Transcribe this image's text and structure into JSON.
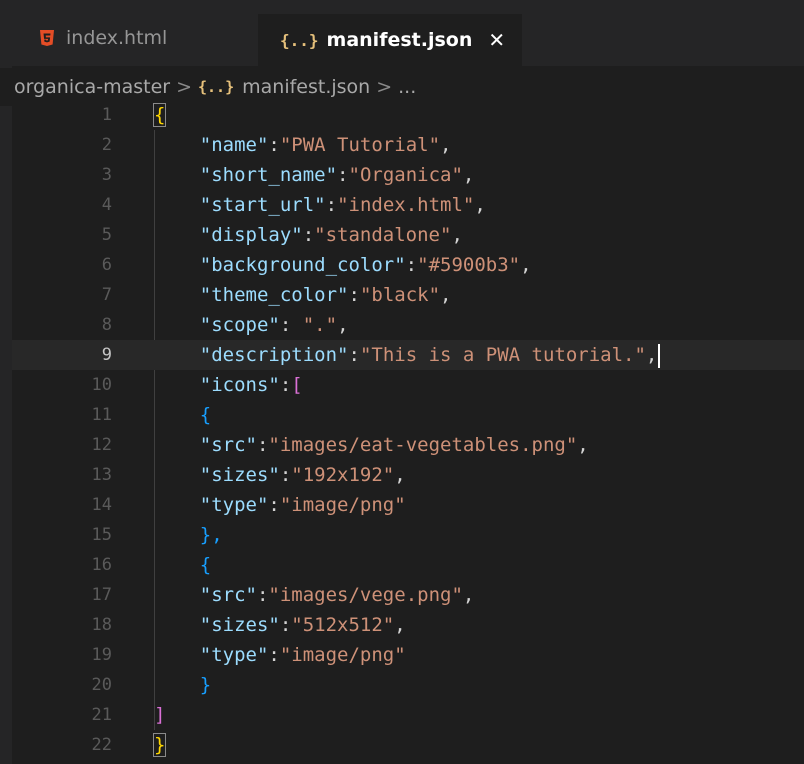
{
  "tabs": [
    {
      "label": "index.html",
      "active": false,
      "icon": "html5-icon"
    },
    {
      "label": "manifest.json",
      "active": true,
      "icon": "json-braces-icon",
      "close": "✕"
    }
  ],
  "breadcrumb": {
    "folder": "organica-master",
    "separator": ">",
    "file_icon": "{..}",
    "file": "manifest.json",
    "more": "..."
  },
  "editor": {
    "current_line": 9,
    "lines": [
      {
        "n": "1"
      },
      {
        "n": "2"
      },
      {
        "n": "3"
      },
      {
        "n": "4"
      },
      {
        "n": "5"
      },
      {
        "n": "6"
      },
      {
        "n": "7"
      },
      {
        "n": "8"
      },
      {
        "n": "9"
      },
      {
        "n": "10"
      },
      {
        "n": "11"
      },
      {
        "n": "12"
      },
      {
        "n": "13"
      },
      {
        "n": "14"
      },
      {
        "n": "15"
      },
      {
        "n": "16"
      },
      {
        "n": "17"
      },
      {
        "n": "18"
      },
      {
        "n": "19"
      },
      {
        "n": "20"
      },
      {
        "n": "21"
      },
      {
        "n": "22"
      }
    ],
    "tokens": {
      "open_brace": "{",
      "k_name": "\"name\"",
      "v_name": "\"PWA Tutorial\"",
      "k_short": "\"short_name\"",
      "v_short": "\"Organica\"",
      "k_start": "\"start_url\"",
      "v_start": "\"index.html\"",
      "k_display": "\"display\"",
      "v_display": "\"standalone\"",
      "k_bg": "\"background_color\"",
      "v_bg": "\"#5900b3\"",
      "k_theme": "\"theme_color\"",
      "v_theme": "\"black\"",
      "k_scope": "\"scope\"",
      "v_scope": "\".\"",
      "k_desc": "\"description\"",
      "v_desc": "\"This is a PWA tutorial.\"",
      "k_icons": "\"icons\"",
      "open_bracket": "[",
      "obj_open": "{",
      "k_src": "\"src\"",
      "v_src1": "\"images/eat-vegetables.png\"",
      "k_sizes": "\"sizes\"",
      "v_sizes1": "\"192x192\"",
      "k_type": "\"type\"",
      "v_type": "\"image/png\"",
      "obj_close_comma": "},",
      "v_src2": "\"images/vege.png\"",
      "v_sizes2": "\"512x512\"",
      "obj_close": "}",
      "close_bracket": "]",
      "close_brace": "}"
    }
  },
  "colors": {
    "background": "#1e1e1e",
    "key": "#9cdcfe",
    "string": "#ce9178",
    "bracket_level1": "#ffd700",
    "bracket_level2": "#da70d6",
    "bracket_level3": "#179fff"
  }
}
